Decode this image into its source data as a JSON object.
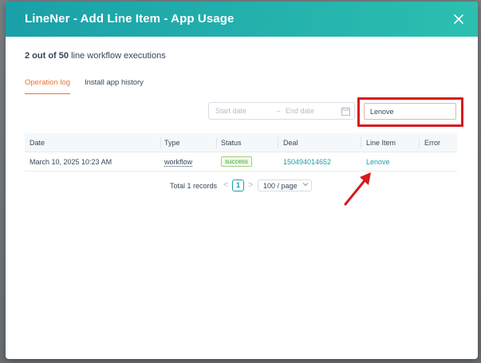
{
  "header": {
    "title": "LineNer - Add Line Item - App Usage",
    "close_icon": "close-icon"
  },
  "summary": {
    "count": "2 out of 50",
    "text": "line workflow executions"
  },
  "tabs": [
    {
      "label": "Operation log",
      "active": true
    },
    {
      "label": "Install app history",
      "active": false
    }
  ],
  "filters": {
    "start_placeholder": "Start date",
    "end_placeholder": "End date",
    "arrow": "→",
    "search_value": "Lenove"
  },
  "table": {
    "columns": [
      "Date",
      "Type",
      "Status",
      "Deal",
      "Line Item",
      "Error"
    ],
    "rows": [
      {
        "date": "March 10, 2025 10:23 AM",
        "type": "workflow",
        "status": "success",
        "deal": "150494014652",
        "line_item": "Lenove",
        "error": ""
      }
    ]
  },
  "pagination": {
    "total": "Total 1 records",
    "prev": "<",
    "current_page": "1",
    "next": ">",
    "page_size": "100 / page"
  },
  "colors": {
    "header_start": "#1aa0a8",
    "header_end": "#2cbfb0",
    "active_tab": "#e8733a",
    "link": "#1f9ea8",
    "highlight": "#d8181e",
    "success": "#37a33b"
  }
}
